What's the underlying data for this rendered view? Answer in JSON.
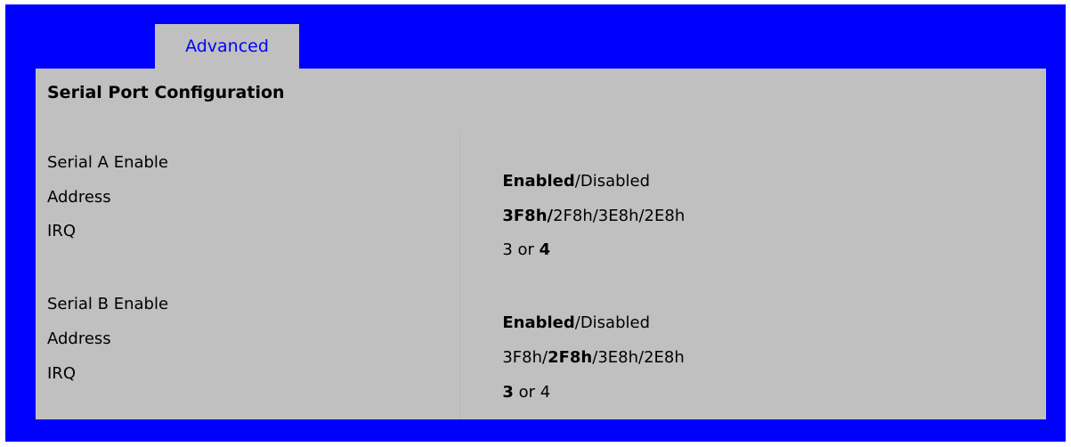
{
  "tabs": [
    {
      "label": "Advanced",
      "active": true
    }
  ],
  "panel": {
    "title": "Serial Port Configuration",
    "rows": [
      {
        "label": "Serial A Enable",
        "options": [
          {
            "text": "Enabled",
            "bold": true
          },
          {
            "text": "/",
            "bold": false
          },
          {
            "text": "Disabled",
            "bold": false
          }
        ]
      },
      {
        "label": "Address",
        "options": [
          {
            "text": "3F8h/",
            "bold": true
          },
          {
            "text": "2F8h/3E8h/2E8h",
            "bold": false
          }
        ]
      },
      {
        "label": "IRQ",
        "options": [
          {
            "text": "3 or ",
            "bold": false
          },
          {
            "text": "4",
            "bold": true
          }
        ]
      },
      {
        "label": "Serial B Enable",
        "options": [
          {
            "text": "Enabled",
            "bold": true
          },
          {
            "text": "/Disabled",
            "bold": false
          }
        ]
      },
      {
        "label": "Address",
        "options": [
          {
            "text": "3F8h/",
            "bold": false
          },
          {
            "text": "2F8h",
            "bold": true
          },
          {
            "text": "/3E8h/2E8h",
            "bold": false
          }
        ]
      },
      {
        "label": "IRQ",
        "options": [
          {
            "text": "3",
            "bold": true
          },
          {
            "text": " or 4",
            "bold": false
          }
        ]
      }
    ]
  },
  "colors": {
    "frame": "#0000ff",
    "panel": "#c0c0c0",
    "tab_text": "#0000ff",
    "text": "#000000"
  }
}
